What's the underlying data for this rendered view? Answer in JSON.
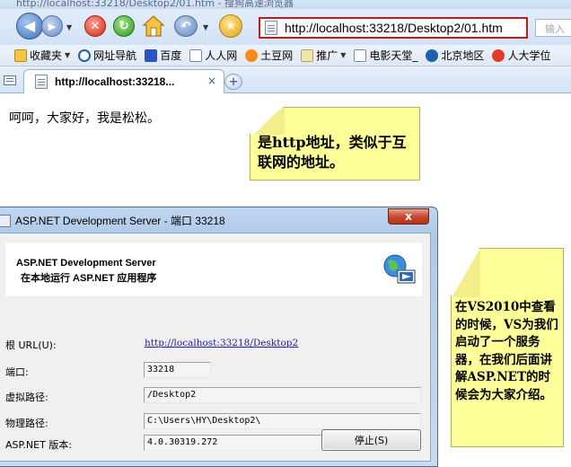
{
  "browser": {
    "window_title": "http://localhost:33218/Desktop2/01.htm - 搜狗高速浏览器",
    "address": "http://localhost:33218/Desktop2/01.htm",
    "search_placeholder": "输入",
    "tab_title": "http://localhost:33218...",
    "tab_close": "×",
    "new_tab": "+",
    "favorites": [
      {
        "label": "收藏夹",
        "icon": "star-folder-icon",
        "dropdown": true
      },
      {
        "label": "网址导航",
        "icon": "sogou-icon",
        "dropdown": false
      },
      {
        "label": "百度",
        "icon": "baidu-paw-icon",
        "dropdown": false
      },
      {
        "label": "人人网",
        "icon": "page-icon",
        "dropdown": false
      },
      {
        "label": "土豆网",
        "icon": "tudou-icon",
        "dropdown": false
      },
      {
        "label": "推广",
        "icon": "folder-icon",
        "dropdown": true
      },
      {
        "label": "电影天堂_",
        "icon": "film-icon",
        "dropdown": false
      },
      {
        "label": "北京地区",
        "icon": "cnblogs-icon",
        "dropdown": false
      },
      {
        "label": "人大学位",
        "icon": "weibo-icon",
        "dropdown": false
      }
    ]
  },
  "page": {
    "text": "呵呵，大家好，我是松松。"
  },
  "notes": {
    "top": "是http地址，类似于互联网的地址。",
    "right": "在VS2010中查看的时候，VS为我们启动了一个服务器，在我们后面讲解ASP.NET的时候会为大家介绍。"
  },
  "dialog": {
    "title": "ASP.NET Development Server - 端口 33218",
    "close": "x",
    "header_line1": "ASP.NET Development Server",
    "header_line2": "在本地运行 ASP.NET 应用程序",
    "fields": {
      "root_url_label": "根 URL(U):",
      "root_url_value": "http://localhost:33218/Desktop2",
      "port_label": "端口:",
      "port_value": "33218",
      "virtual_path_label": "虚拟路径:",
      "virtual_path_value": "/Desktop2",
      "physical_path_label": "物理路径:",
      "physical_path_value": "C:\\Users\\HY\\Desktop2\\",
      "version_label": "ASP.NET 版本:",
      "version_value": "4.0.30319.272"
    },
    "stop_button": "停止(S)"
  },
  "colors": {
    "address_highlight": "#c81818",
    "note_yellow": "#ffff99",
    "link_blue": "#1a1aa6"
  }
}
